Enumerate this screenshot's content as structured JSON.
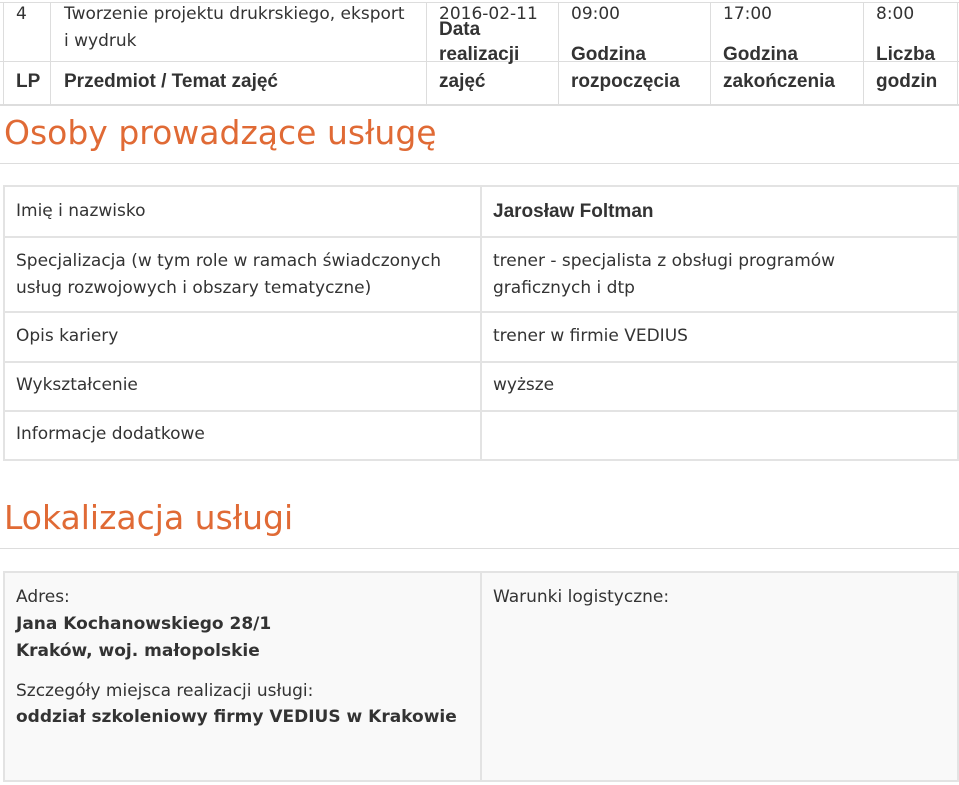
{
  "schedule": {
    "row": {
      "lp": "4",
      "subject": "Tworzenie projektu drukrskiego, eksport i wydruk",
      "date": "2016-02-11",
      "start": "09:00",
      "end": "17:00",
      "hours": "8:00"
    },
    "headers": {
      "lp": "LP",
      "subject": "Przedmiot / Temat zajęć",
      "date_line1": "Data",
      "date_line2": "realizacji",
      "date_line3": "zajęć",
      "start_line1": "Godzina",
      "start_line2": "rozpoczęcia",
      "end_line1": "Godzina",
      "end_line2": "zakończenia",
      "hours_line1": "Liczba",
      "hours_line2": "godzin"
    }
  },
  "trainers": {
    "title": "Osoby prowadzące usługę",
    "rows": [
      {
        "label": "Imię i nazwisko",
        "value": "Jarosław Foltman"
      },
      {
        "label": "Specjalizacja (w tym role w ramach świadczonych usług rozwojowych i obszary tematyczne)",
        "value": "trener - specjalista z obsługi programów graficznych i dtp"
      },
      {
        "label": "Opis kariery",
        "value": "trener w firmie VEDIUS"
      },
      {
        "label": "Wykształcenie",
        "value": "wyższe"
      },
      {
        "label": "Informacje dodatkowe",
        "value": ""
      }
    ]
  },
  "location": {
    "title": "Lokalizacja usługi",
    "address_label": "Adres:",
    "address_line1": "Jana Kochanowskiego 28/1",
    "address_line2": "Kraków, woj. małopolskie",
    "details_label": "Szczegóły miejsca realizacji usługi:",
    "details_value": "oddział szkoleniowy firmy VEDIUS w Krakowie",
    "logistics_label": "Warunki logistyczne:"
  }
}
